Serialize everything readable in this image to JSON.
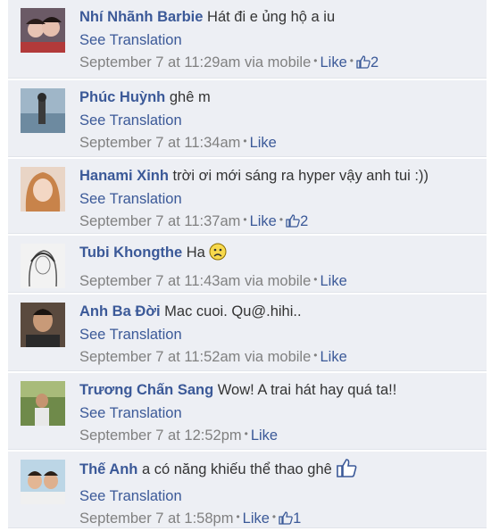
{
  "see_translation": "See Translation",
  "like_label": "Like",
  "comments": [
    {
      "author": "Nhí Nhãnh Barbie",
      "text": "Hát đi e ủng hộ a iu",
      "time": "September 7 at 11:29am",
      "via": "via mobile",
      "likes": "2"
    },
    {
      "author": "Phúc Huỳnh",
      "text": "ghê m",
      "time": "September 7 at 11:34am",
      "via": "",
      "likes": ""
    },
    {
      "author": "Hanami Xinh",
      "text": "trời ơi mới sáng ra hyper vậy anh tui :))",
      "time": "September 7 at 11:37am",
      "via": "",
      "likes": "2"
    },
    {
      "author": "Tubi Khongthe",
      "text": "Ha",
      "time": "September 7 at 11:43am",
      "via": "via mobile",
      "likes": "",
      "emoticon": "frown-emoticon"
    },
    {
      "author": "Anh Ba Đời",
      "text": "Mac cuoi. Qu@.hihi..",
      "time": "September 7 at 11:52am",
      "via": "via mobile",
      "likes": ""
    },
    {
      "author": "Trương Chấn Sang",
      "text": "Wow! A trai hát hay quá ta!!",
      "time": "September 7 at 12:52pm",
      "via": "",
      "likes": ""
    },
    {
      "author": "Thế Anh",
      "text": "a có năng khiếu thể thao ghê",
      "time": "September 7 at 1:58pm",
      "via": "",
      "likes": "1",
      "emoticon": "thumbs-up-emoticon"
    }
  ],
  "colors": {
    "link": "#3b5998",
    "meta": "#808080",
    "row_bg": "#edeff4"
  }
}
